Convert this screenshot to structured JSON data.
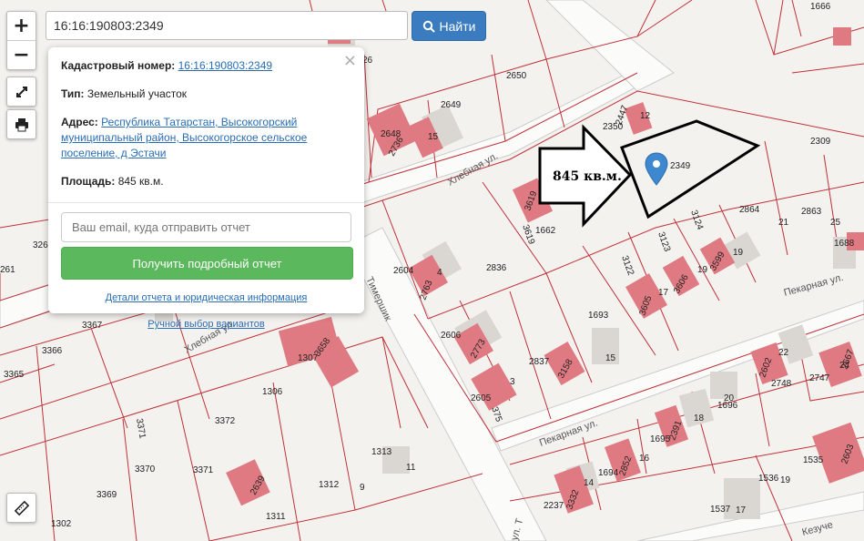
{
  "search": {
    "value": "16:16:190803:2349",
    "button_label": "Найти"
  },
  "controls": {
    "zoom_in": "+",
    "zoom_out": "−"
  },
  "popup": {
    "cadastral_label": "Кадастровый номер:",
    "cadastral_value": "16:16:190803:2349",
    "type_label": "Тип:",
    "type_value": "Земельный участок",
    "address_label": "Адрес:",
    "address_value": "Республика Татарстан, Высокогорский муниципальный район, Высокогорское сельское поселение, д Эстачи",
    "area_label": "Площадь:",
    "area_value": "845 кв.м.",
    "email_placeholder": "Ваш email, куда отправить отчет",
    "report_button": "Получить подробный отчет",
    "details_link": "Детали отчета и юридическая информация",
    "manual_link": "Ручной выбор вариантов",
    "close": "×"
  },
  "annotation": {
    "text": "845 кв.м."
  },
  "streets": {
    "khlebnaya_1": "Хлебная ул.",
    "khlebnaya_2": "Хлебная ул.",
    "timershik": "Тимершик",
    "pekarnaya_1": "Пекарная ул.",
    "pekarnaya_2": "Пекарная ул.",
    "ul_t": "ул. Т",
    "kezuche": "Кезуче"
  },
  "parcels": {
    "p1666": "1666",
    "p26": "26",
    "p2650": "2650",
    "p2649": "2649",
    "p2648": "2648",
    "p2736": "2736",
    "p15a": "15",
    "p2350": "2350",
    "p2447": "2447",
    "p12": "12",
    "p2349": "2349",
    "p2309": "2309",
    "p3619a": "3619",
    "p3619b": "3619",
    "p1662": "1662",
    "p3124": "3124",
    "p2864": "2864",
    "p21": "21",
    "p2863": "2863",
    "p25": "25",
    "p1688": "1688",
    "p3123": "3123",
    "p3122": "3122",
    "p3599": "3599",
    "p19a": "19",
    "p19b": "19",
    "p3606": "3606",
    "p17a": "17",
    "p3605": "3605",
    "p3261": "326",
    "p261": "261",
    "p2604": "2604",
    "p4": "4",
    "p2763": "2763",
    "p2836": "2836",
    "p3367": "3367",
    "p3366": "3366",
    "p3365": "3365",
    "p1307": "1307",
    "p3658": "3658",
    "p1693": "1693",
    "p15b": "15",
    "p2606": "2606",
    "p2773": "2773",
    "p2837": "2837",
    "p3158": "3158",
    "p3": "3",
    "p2605": "2605",
    "p375": "375",
    "p22": "22",
    "p2602": "2602",
    "p2748": "2748",
    "p24": "24",
    "p2747": "2747",
    "p2667": "2667",
    "p1306": "1306",
    "p3371a": "3371",
    "p3372": "3372",
    "p1313": "1313",
    "p11": "11",
    "p1696": "1696",
    "p20": "20",
    "p18": "18",
    "p1695": "1695",
    "p2391": "2391",
    "p16": "16",
    "p1694": "1694",
    "p2852": "2852",
    "p3370": "3370",
    "p3371b": "3371",
    "p1312": "1312",
    "p2639": "2639",
    "p9": "9",
    "p1535": "1535",
    "p2603": "2603",
    "p1536": "1536",
    "p19c": "19",
    "p3369": "3369",
    "p1311": "1311",
    "p2237": "2237",
    "p3332": "3332",
    "p14": "14",
    "p1537": "1537",
    "p17b": "17",
    "p1302": "1302"
  },
  "colors": {
    "parcel_line": "#c0303a",
    "building": "#e07a82",
    "building_shadow": "#d8d5d0",
    "road": "#fafafa",
    "selected": "#000000",
    "marker": "#3e88d0"
  }
}
